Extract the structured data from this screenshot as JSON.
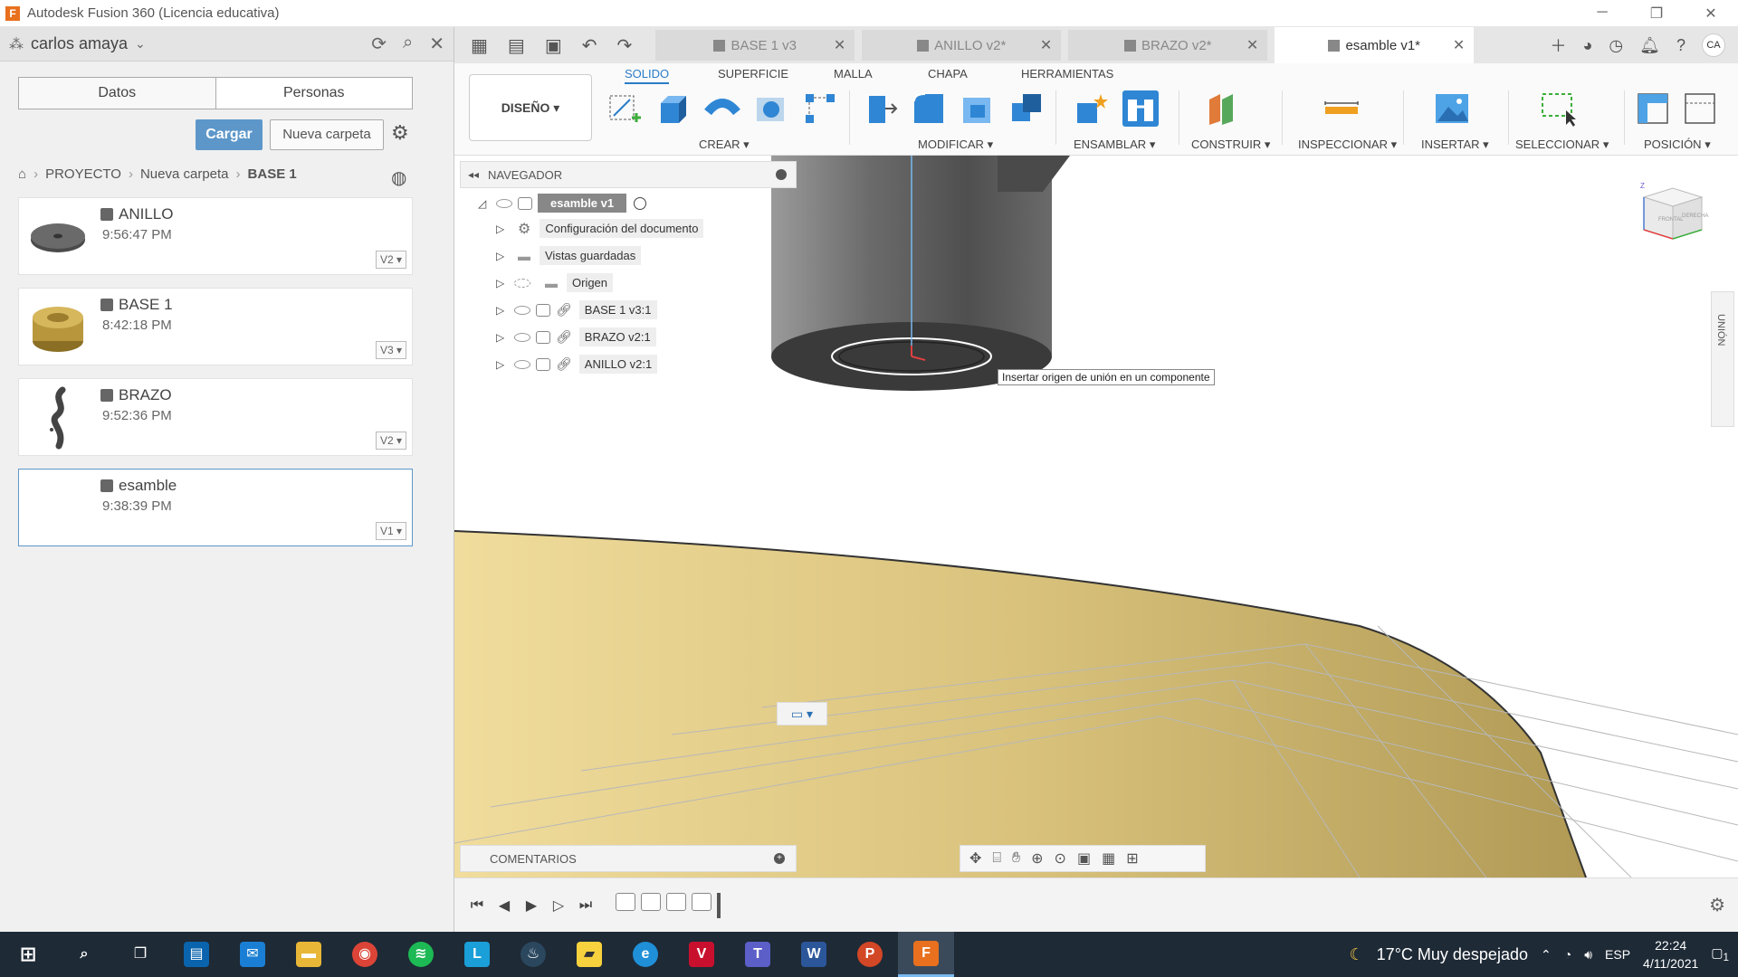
{
  "window": {
    "app_icon": "F",
    "title": "Autodesk Fusion 360 (Licencia educativa)",
    "controls": [
      "minimize",
      "restore",
      "close"
    ]
  },
  "data_panel": {
    "user": "carlos amaya",
    "tabs": [
      {
        "label": "Datos"
      },
      {
        "label": "Personas"
      }
    ],
    "upload_button": "Cargar",
    "new_folder_button": "Nueva carpeta",
    "breadcrumb": [
      "PROYECTO",
      "Nueva carpeta",
      "BASE 1"
    ],
    "files": [
      {
        "name": "ANILLO",
        "time": "9:56:47 PM",
        "version": "V2",
        "thumb_color": "#555555"
      },
      {
        "name": "BASE 1",
        "time": "8:42:18 PM",
        "version": "V3",
        "thumb_color": "#b8973c"
      },
      {
        "name": "BRAZO",
        "time": "9:52:36 PM",
        "version": "V2",
        "thumb_color": "#444444"
      },
      {
        "name": "esamble",
        "time": "9:38:39 PM",
        "version": "V1",
        "thumb_color": "#ffffff"
      }
    ]
  },
  "doc_tabs": [
    {
      "label": "BASE 1 v3",
      "active": false
    },
    {
      "label": "ANILLO v2*",
      "active": false
    },
    {
      "label": "BRAZO v2*",
      "active": false
    },
    {
      "label": "esamble v1*",
      "active": true
    }
  ],
  "user_initials": "CA",
  "ribbon": {
    "workspace": "DISEÑO",
    "tabs": [
      {
        "label": "SOLIDO",
        "active": true
      },
      {
        "label": "SUPERFICIE"
      },
      {
        "label": "MALLA"
      },
      {
        "label": "CHAPA"
      },
      {
        "label": "HERRAMIENTAS"
      }
    ],
    "groups": [
      {
        "label": "CREAR"
      },
      {
        "label": "MODIFICAR"
      },
      {
        "label": "ENSAMBLAR"
      },
      {
        "label": "CONSTRUIR"
      },
      {
        "label": "INSPECCIONAR"
      },
      {
        "label": "INSERTAR"
      },
      {
        "label": "SELECCIONAR"
      },
      {
        "label": "POSICIÓN"
      }
    ]
  },
  "browser": {
    "title": "NAVEGADOR",
    "root": "esamble v1",
    "items": [
      {
        "label": "Configuración del documento"
      },
      {
        "label": "Vistas guardadas"
      },
      {
        "label": "Origen"
      },
      {
        "label": "BASE 1 v3:1"
      },
      {
        "label": "BRAZO v2:1"
      },
      {
        "label": "ANILLO v2:1"
      }
    ]
  },
  "viewport": {
    "tooltip": "Insertar origen de unión en un componente",
    "viewcube_faces": [
      "FRONTAL",
      "DERECHA"
    ],
    "union_panel": "UNIÓN",
    "model_color": "#d9c27c"
  },
  "comments_label": "COMENTARIOS",
  "taskbar": {
    "weather": "17°C  Muy despejado",
    "language": "ESP",
    "time": "22:24",
    "date": "4/11/2021",
    "notifications": "1"
  }
}
